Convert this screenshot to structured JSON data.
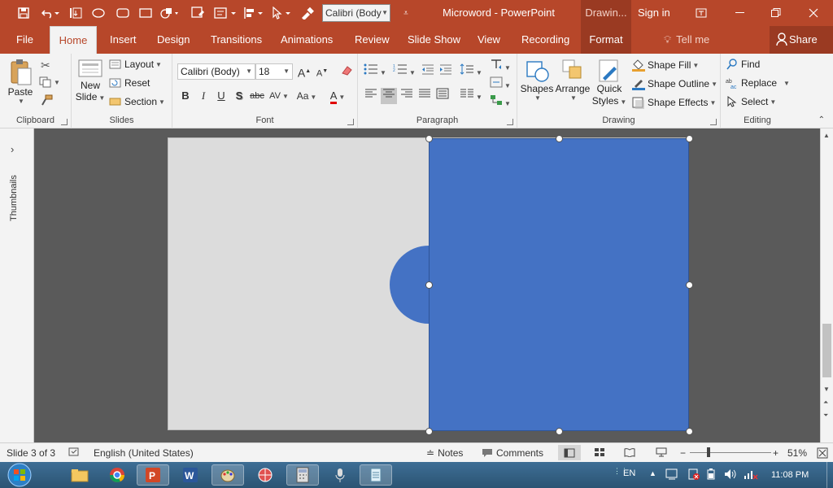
{
  "window": {
    "doc_title": "Microword  -  PowerPoint",
    "contextual_group": "Drawin...",
    "sign_in": "Sign in",
    "quick_font": "Calibri (Body"
  },
  "tabs": [
    {
      "label": "File"
    },
    {
      "label": "Home",
      "active": true
    },
    {
      "label": "Insert"
    },
    {
      "label": "Design"
    },
    {
      "label": "Transitions"
    },
    {
      "label": "Animations"
    },
    {
      "label": "Review"
    },
    {
      "label": "Slide Show"
    },
    {
      "label": "View"
    },
    {
      "label": "Recording"
    },
    {
      "label": "Format"
    }
  ],
  "tell_me": "Tell me",
  "share": "Share",
  "ribbon": {
    "clipboard": {
      "label": "Clipboard",
      "paste": "Paste"
    },
    "slides": {
      "label": "Slides",
      "new_slide": "New",
      "new_slide_2": "Slide",
      "layout": "Layout",
      "reset": "Reset",
      "section": "Section"
    },
    "font": {
      "label": "Font",
      "family": "Calibri (Body)",
      "size": "18",
      "bold": "B",
      "italic": "I",
      "underline": "U",
      "shadow": "S",
      "strike": "abc",
      "spacing": "AV",
      "case": "Aa",
      "color": "A",
      "grow": "A",
      "shrink": "A"
    },
    "paragraph": {
      "label": "Paragraph"
    },
    "drawing": {
      "label": "Drawing",
      "shapes": "Shapes",
      "arrange": "Arrange",
      "quick": "Quick",
      "styles": "Styles",
      "fill": "Shape Fill",
      "outline": "Shape Outline",
      "effects": "Shape Effects"
    },
    "editing": {
      "label": "Editing",
      "find": "Find",
      "replace": "Replace",
      "select": "Select"
    }
  },
  "thumbnails": "Thumbnails",
  "slide": {
    "fill": "#dcdcdc",
    "shape_fill": "#4472c4"
  },
  "status": {
    "slide_info": "Slide 3 of 3",
    "language": "English (United States)",
    "notes": "Notes",
    "comments": "Comments",
    "zoom": "51%"
  },
  "taskbar": {
    "lang": "EN",
    "time": "11:08 PM"
  },
  "colors": {
    "accent": "#b7472a",
    "accent_dark": "#9a3a22",
    "shape": "#4472c4",
    "font_red": "#e00000"
  }
}
